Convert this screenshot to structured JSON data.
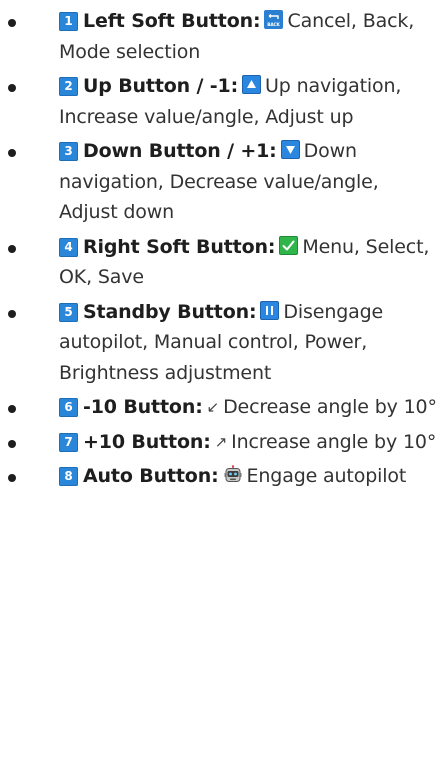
{
  "buttons": [
    {
      "number": "1",
      "label": "Left Soft Button:",
      "icon": "back-icon",
      "description": "Cancel, Back, Mode selection"
    },
    {
      "number": "2",
      "label": "Up Button / -1:",
      "icon": "up-triangle-icon",
      "description": "Up navigation, Increase value/angle, Adjust up"
    },
    {
      "number": "3",
      "label": "Down Button / +1:",
      "icon": "down-triangle-icon",
      "description": "Down navigation, Decrease value/angle, Adjust down"
    },
    {
      "number": "4",
      "label": "Right Soft Button:",
      "icon": "checkmark-icon",
      "description": "Menu, Select, OK, Save"
    },
    {
      "number": "5",
      "label": "Standby Button:",
      "icon": "pause-icon",
      "description": "Disengage autopilot, Manual control, Power, Brightness adjustment"
    },
    {
      "number": "6",
      "label": "-10 Button:",
      "icon": "arrow-down-left-icon",
      "glyph": "↙",
      "description": "Decrease angle by 10°"
    },
    {
      "number": "7",
      "label": "+10 Button:",
      "icon": "arrow-up-right-icon",
      "glyph": "↗",
      "description": "Increase angle by 10°"
    },
    {
      "number": "8",
      "label": "Auto Button:",
      "icon": "robot-icon",
      "description": "Engage autopilot"
    }
  ],
  "colors": {
    "number_badge": "#2a86d9",
    "check_icon": "#2fb54a",
    "blue_icon": "#2b86e0"
  }
}
